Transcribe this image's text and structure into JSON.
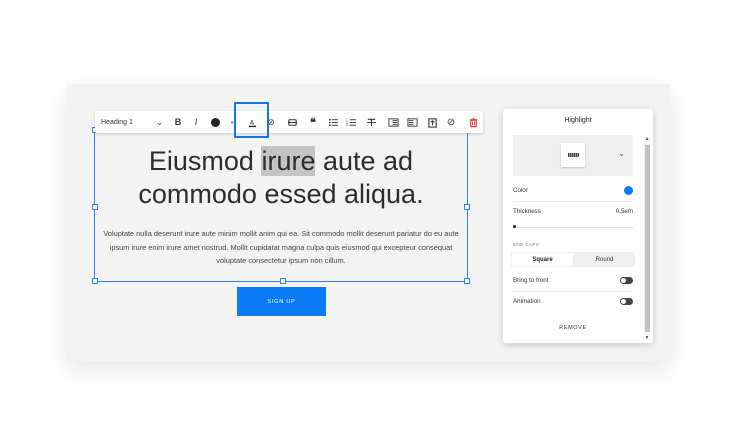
{
  "toolbar": {
    "style_select": "Heading 1",
    "icons": [
      "bold-icon",
      "italic-icon",
      "color-icon",
      "link-remove-icon",
      "highlight-icon",
      "link-icon",
      "strikethrough-bar-icon",
      "quote-icon",
      "bullet-list-icon",
      "numbered-list-icon",
      "strikethrough-icon",
      "indent-decrease-icon",
      "indent-increase-icon",
      "insert-block-icon",
      "clear-format-icon",
      "delete-icon"
    ]
  },
  "content": {
    "heading_part1": "Eiusmod ",
    "heading_highlight": "irure",
    "heading_part2": " aute ad commodo essed aliqua.",
    "body": "Voluptate nulla deserunt irure aute minim mollit anim qui ea. Sit commodo mollit deserunt pariatur do eu aute ipsum irure enim irure amet nostrud. Mollit cupidatat magna culpa quis eiusmod qui excepteur consequat voluptate consectetur ipsum non cillum.",
    "button": "SIGN UP"
  },
  "panel": {
    "title": "Highlight",
    "color_label": "Color",
    "color_value": "#0a7bf5",
    "thickness_label": "Thickness",
    "thickness_value": "0.5em",
    "end_caps_label": "END CAPS",
    "end_caps_options": [
      "Square",
      "Round"
    ],
    "end_caps_selected": "Square",
    "bring_to_front_label": "Bring to front",
    "animation_label": "Animation",
    "remove_label": "REMOVE"
  }
}
